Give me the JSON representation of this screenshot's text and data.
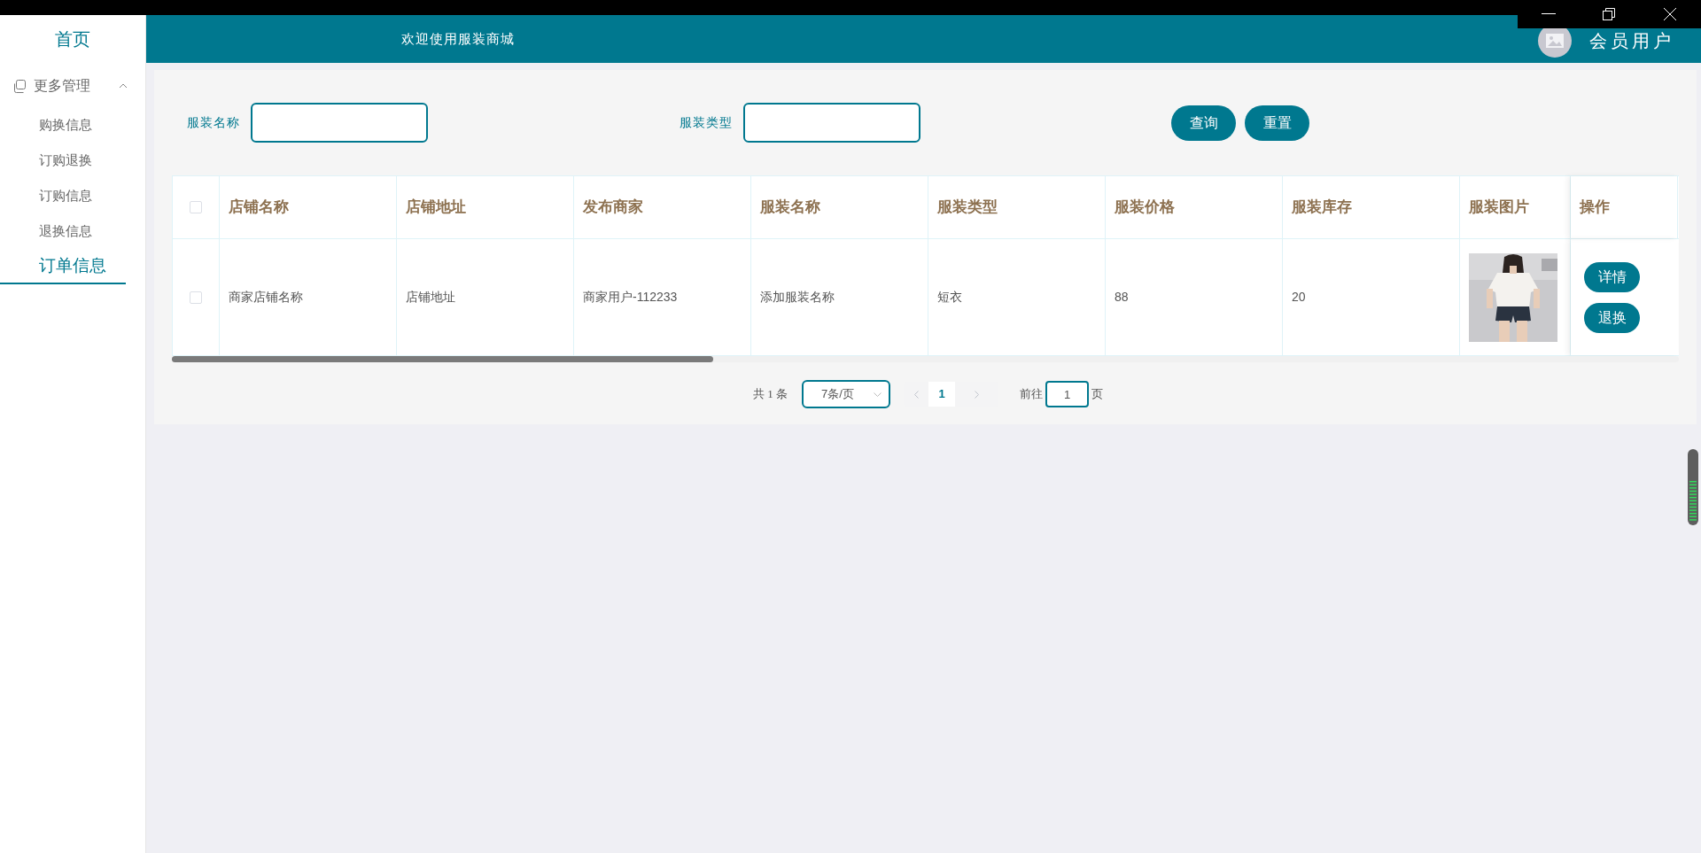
{
  "sidebar": {
    "home": "首页",
    "groups": [
      {
        "label": "更多管理",
        "expanded": true,
        "items": [
          {
            "label": "购换信息",
            "selected": false
          },
          {
            "label": "订购退换",
            "selected": false
          },
          {
            "label": "订购信息",
            "selected": false
          },
          {
            "label": "退换信息",
            "selected": false
          },
          {
            "label": "订单信息",
            "selected": true
          }
        ]
      }
    ]
  },
  "header": {
    "title": "欢迎使用服装商城",
    "user": "会员用户"
  },
  "search": {
    "fields": [
      {
        "label": "服装名称"
      },
      {
        "label": "服装类型"
      }
    ],
    "buttons": [
      "查询",
      "重置"
    ]
  },
  "table": {
    "header_checked": false,
    "columns": [
      "店铺名称",
      "店铺地址",
      "发布商家",
      "服装名称",
      "服装类型",
      "服装价格",
      "服装库存",
      "服装图片",
      "操作"
    ],
    "rows": [
      {
        "checked": false,
        "cells": [
          {
            "kind": "text",
            "text": "商家店铺名称"
          },
          {
            "kind": "text",
            "text": "店铺地址"
          },
          {
            "kind": "text",
            "text": "商家用户-112233"
          },
          {
            "kind": "text",
            "text": "添加服装名称"
          },
          {
            "kind": "text",
            "text": "短衣"
          },
          {
            "kind": "text",
            "text": "88"
          },
          {
            "kind": "text",
            "text": "20"
          },
          {
            "kind": "picture"
          }
        ],
        "actions": [
          "详情",
          "退换"
        ]
      }
    ]
  },
  "pagination": {
    "total": "共 1 条",
    "page_size": "7条/页",
    "pages": [
      {
        "label": "1",
        "selected": true
      }
    ],
    "goto_label": "前往",
    "goto_value": "1",
    "page_suffix": "页"
  }
}
